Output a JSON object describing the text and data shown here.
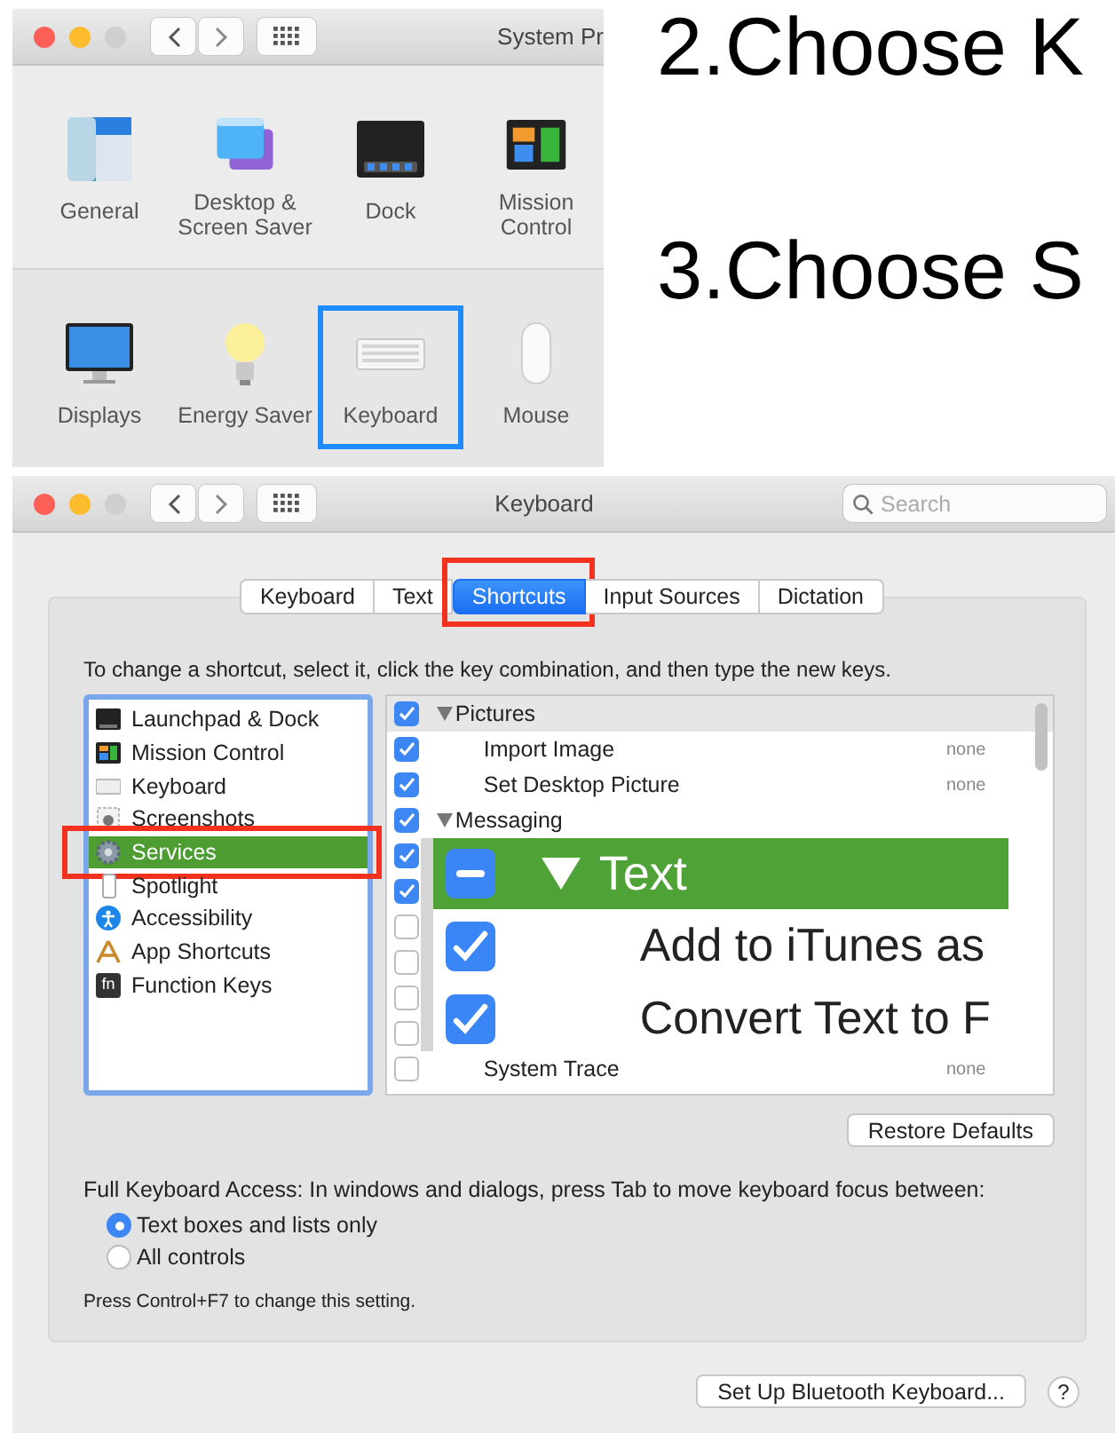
{
  "steps": [
    {
      "text": "2.Choose K"
    },
    {
      "text": "3.Choose S"
    }
  ],
  "prefs_window": {
    "title": "System Pr",
    "sections": [
      {
        "panes": [
          {
            "label": "General",
            "selected": false
          },
          {
            "label": "Desktop & Screen Saver",
            "selected": false
          },
          {
            "label": "Dock",
            "selected": false
          },
          {
            "label": "Mission Control",
            "selected": false
          }
        ]
      },
      {
        "panes": [
          {
            "label": "Displays",
            "selected": false
          },
          {
            "label": "Energy Saver",
            "selected": false
          },
          {
            "label": "Keyboard",
            "selected": true
          },
          {
            "label": "Mouse",
            "selected": false
          }
        ]
      }
    ]
  },
  "keyboard_window": {
    "title": "Keyboard",
    "search": {
      "placeholder": "Search"
    },
    "tabs": [
      {
        "label": "Keyboard",
        "selected": false
      },
      {
        "label": "Text",
        "selected": false
      },
      {
        "label": "Shortcuts",
        "selected": true
      },
      {
        "label": "Input Sources",
        "selected": false
      },
      {
        "label": "Dictation",
        "selected": false
      }
    ],
    "instruction": "To change a shortcut, select it, click the key combination, and then type the new keys.",
    "categories": [
      {
        "label": "Launchpad & Dock",
        "selected": false
      },
      {
        "label": "Mission Control",
        "selected": false
      },
      {
        "label": "Keyboard",
        "selected": false
      },
      {
        "label": "Screenshots",
        "selected": false
      },
      {
        "label": "Services",
        "selected": true
      },
      {
        "label": "Spotlight",
        "selected": false
      },
      {
        "label": "Accessibility",
        "selected": false
      },
      {
        "label": "App Shortcuts",
        "selected": false
      },
      {
        "label": "Function Keys",
        "icon_text": "fn",
        "selected": false
      }
    ],
    "shortcuts": [
      {
        "kind": "group",
        "label": "Pictures",
        "checked": true,
        "selected": true
      },
      {
        "kind": "item",
        "label": "Import Image",
        "shortcut": "none",
        "checked": true,
        "selected": false
      },
      {
        "kind": "item",
        "label": "Set Desktop Picture",
        "shortcut": "none",
        "checked": true,
        "selected": false
      },
      {
        "kind": "group",
        "label": "Messaging",
        "checked": true,
        "selected": false
      },
      {
        "kind": "hidden",
        "checked": true,
        "selected": false
      },
      {
        "kind": "hidden",
        "checked": true,
        "selected": false
      },
      {
        "kind": "hidden",
        "checked": false,
        "selected": false
      },
      {
        "kind": "hidden",
        "checked": false,
        "selected": false
      },
      {
        "kind": "hidden",
        "checked": false,
        "selected": false
      },
      {
        "kind": "hidden",
        "checked": false,
        "selected": false
      },
      {
        "kind": "item",
        "label": "System Trace",
        "shortcut": "none",
        "checked": false,
        "selected": false
      }
    ],
    "magnifier": {
      "header": {
        "label": "Text",
        "mixed": true
      },
      "rows": [
        {
          "label": "Add to iTunes as",
          "checked": true
        },
        {
          "label": "Convert Text to F",
          "checked": true
        }
      ]
    },
    "restore_button": "Restore Defaults",
    "access_label": "Full Keyboard Access: In windows and dialogs, press Tab to move keyboard focus between:",
    "access_options": [
      {
        "label": "Text boxes and lists only",
        "selected": true
      },
      {
        "label": "All controls",
        "selected": false
      }
    ],
    "note": "Press Control+F7 to change this setting.",
    "bluetooth_button": "Set Up Bluetooth Keyboard...",
    "help_button": "?"
  }
}
